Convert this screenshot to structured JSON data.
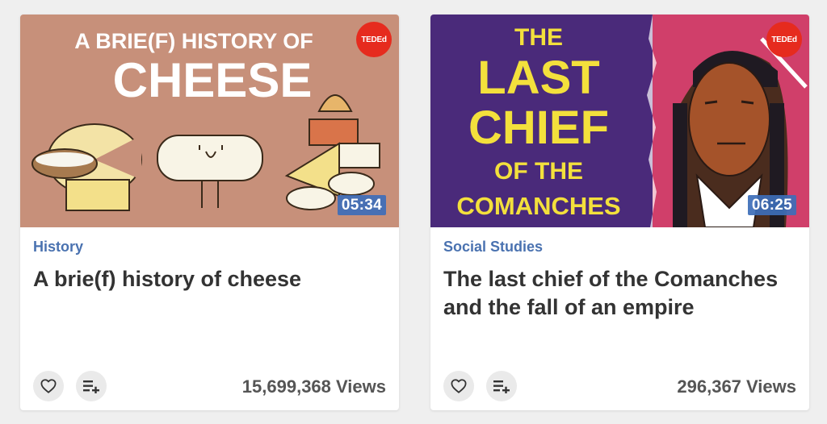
{
  "cards": [
    {
      "thumbnail_text": [
        "A BRIE(F) HISTORY OF",
        "CHEESE"
      ],
      "badge": "TEDEd",
      "duration": "05:34",
      "category": "History",
      "title": "A brie(f) history of cheese",
      "views": "15,699,368 Views",
      "like_icon": "heart-icon",
      "playlist_icon": "add-to-playlist-icon"
    },
    {
      "thumbnail_text": [
        "THE",
        "LAST",
        "CHIEF",
        "OF THE",
        "COMANCHES"
      ],
      "badge": "TEDEd",
      "duration": "06:25",
      "category": "Social Studies",
      "title": "The last chief of the Comanches and the fall of an empire",
      "views": "296,367 Views",
      "like_icon": "heart-icon",
      "playlist_icon": "add-to-playlist-icon"
    }
  ],
  "colors": {
    "category_blue": "#4a72b0",
    "ted_red": "#e62b1e",
    "duration_blue": "#3d6eb8",
    "cheese_bg": "#c7907a",
    "comanche_purple": "#4a2a7a",
    "comanche_yellow": "#f3e03c"
  }
}
